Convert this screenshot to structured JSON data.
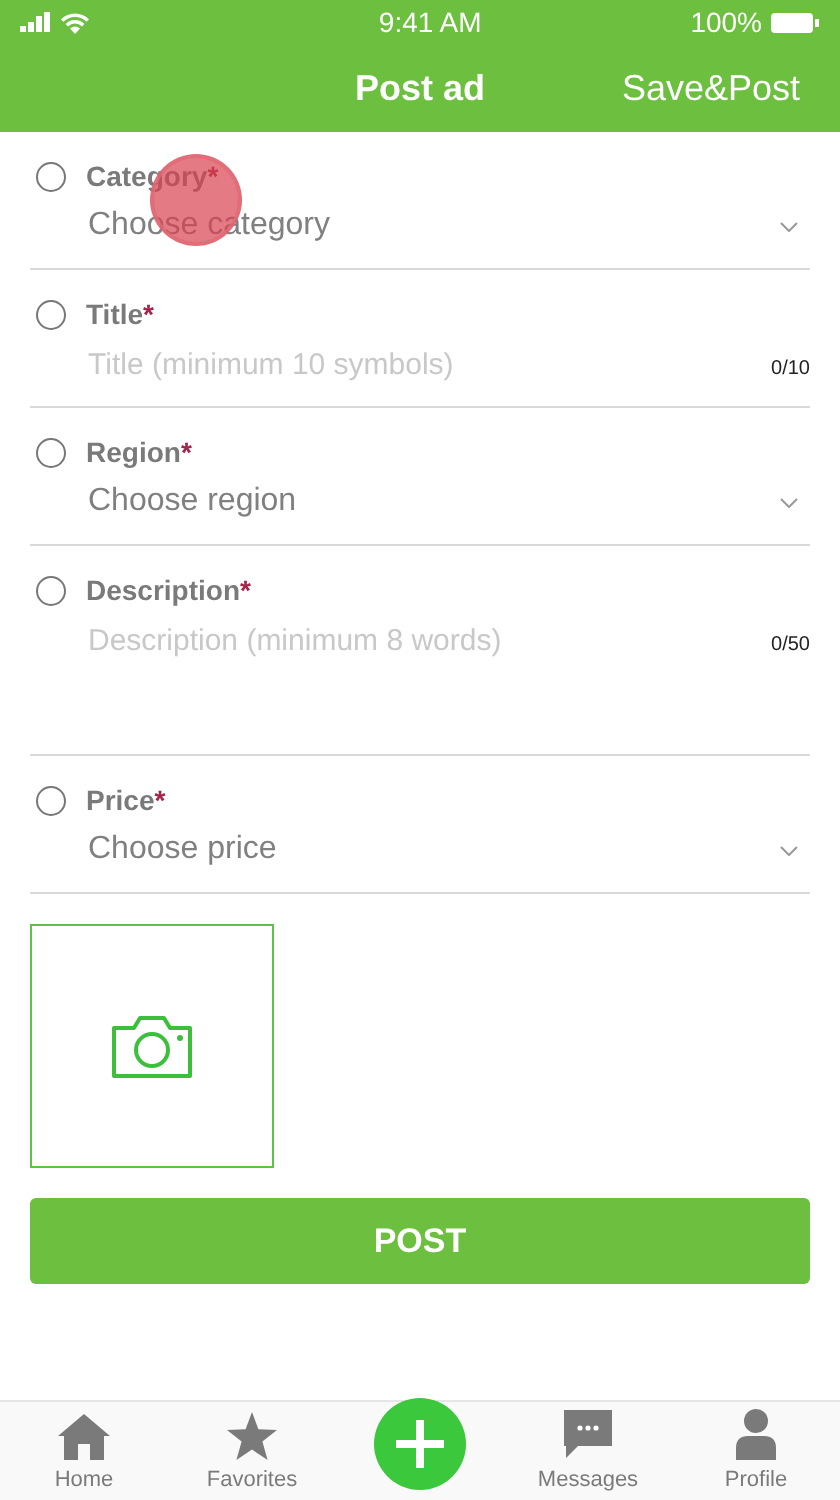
{
  "status_bar": {
    "time": "9:41 AM",
    "battery": "100%"
  },
  "nav_bar": {
    "title": "Post ad",
    "action": "Save&Post"
  },
  "fields": [
    {
      "kind": "select",
      "label": "Category",
      "required_mark": "*",
      "checked": false,
      "value": "Choose category"
    },
    {
      "kind": "text",
      "label": "Title",
      "required_mark": "*",
      "checked": false,
      "placeholder": "Title (minimum 10 symbols)",
      "counter": "0/10"
    },
    {
      "kind": "select",
      "label": "Region",
      "required_mark": "*",
      "checked": false,
      "value": "Choose region"
    },
    {
      "kind": "textarea",
      "label": "Description",
      "required_mark": "*",
      "checked": false,
      "placeholder": "Description (minimum 8 words)",
      "counter": "0/50"
    },
    {
      "kind": "select",
      "label": "Price",
      "required_mark": "*",
      "checked": false,
      "value": "Choose price"
    }
  ],
  "photo_upload": {
    "kind": "camera"
  },
  "submit_button": "POST",
  "tab_bar": [
    {
      "kind": "home",
      "label": "Home",
      "selected": false
    },
    {
      "kind": "favorites",
      "label": "Favorites",
      "selected": false
    },
    {
      "kind": "add",
      "selected": false
    },
    {
      "kind": "messages",
      "label": "Messages",
      "selected": false
    },
    {
      "kind": "profile",
      "label": "Profile",
      "selected": false
    }
  ],
  "touch_indicator": true
}
